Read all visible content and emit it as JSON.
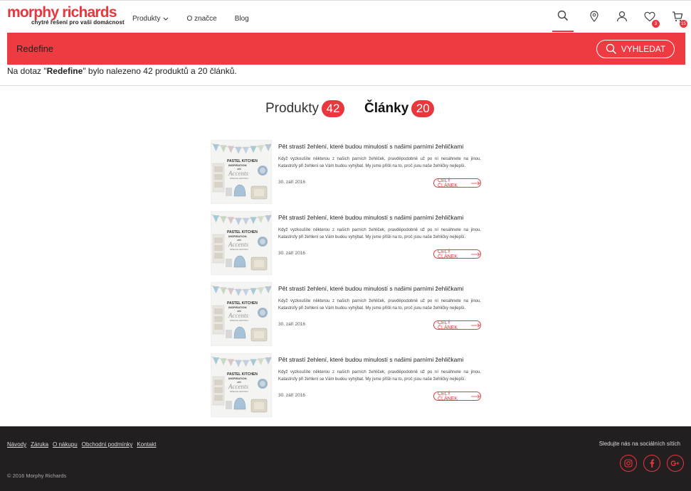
{
  "logo": {
    "brand": "morphy richards",
    "tagline": "chytré řešení pro vaši domácnost"
  },
  "nav": [
    {
      "label": "Produkty",
      "has_dropdown": true
    },
    {
      "label": "O značce"
    },
    {
      "label": "Blog"
    }
  ],
  "header_icons": {
    "wishlist_count": "3",
    "cart_count": "15"
  },
  "search": {
    "value": "Redefine",
    "button_label": "VYHLEDAT"
  },
  "result_info": {
    "prefix": "Na dotaz \"",
    "query": "Redefine",
    "suffix": "\" bylo nalezeno 42 produktů a 20 článků."
  },
  "tabs": [
    {
      "label": "Produkty",
      "count": "42",
      "active": false
    },
    {
      "label": "Články",
      "count": "20",
      "active": true
    }
  ],
  "articles": [
    {
      "title": "Pět strastí žehlení, které budou minulostí s našimi parními žehličkami",
      "text": "Když vyzkoušíte některou z našich parních žehliček, pravděpodobně už po ní nesáhnete na jinou. Katastrofy při žehlení se Vám budou vyhýbat. My jsme přišli na to, proč jsou naše žehličky nejlepší.",
      "date": "30. září 2016",
      "button": "CELÝ ČLÁNEK"
    },
    {
      "title": "Pět strastí žehlení, které budou minulostí s našimi parními žehličkami",
      "text": "Když vyzkoušíte některou z našich parních žehliček, pravděpodobně už po ní nesáhnete na jinou. Katastrofy při žehlení se Vám budou vyhýbat. My jsme přišli na to, proč jsou naše žehličky nejlepší.",
      "date": "30. září 2016",
      "button": "CELÝ ČLÁNEK"
    },
    {
      "title": "Pět strastí žehlení, které budou minulostí s našimi parními žehličkami",
      "text": "Když vyzkoušíte některou z našich parních žehliček, pravděpodobně už po ní nesáhnete na jinou. Katastrofy při žehlení se Vám budou vyhýbat. My jsme přišli na to, proč jsou naše žehličky nejlepší.",
      "date": "30. září 2016",
      "button": "CELÝ ČLÁNEK"
    },
    {
      "title": "Pět strastí žehlení, které budou minulostí s našimi parními žehličkami",
      "text": "Když vyzkoušíte některou z našich parních žehliček, pravděpodobně už po ní nesáhnete na jinou. Katastrofy při žehlení se Vám budou vyhýbat. My jsme přišli na to, proč jsou naše žehličky nejlepší.",
      "date": "30. září 2016",
      "button": "CELÝ ČLÁNEK"
    }
  ],
  "thumb": {
    "line1": "PASTEL KITCHEN",
    "line2": "INSPIRATION",
    "line3": "with",
    "line4": "Accents",
    "line5": "SPECIAL EDITION"
  },
  "footer": {
    "links": [
      "Návody",
      "Záruka",
      "O nákupu",
      "Obchodní podmínky",
      "Kontakt"
    ],
    "copyright": "© 2016 Morphy Richards",
    "social_text": "Sledujte nás na sociálních sítích",
    "social": [
      "instagram-icon",
      "facebook-icon",
      "google-plus-icon"
    ]
  },
  "colors": {
    "brand_red": "#e8373d",
    "footer_bg": "#231e1f"
  }
}
